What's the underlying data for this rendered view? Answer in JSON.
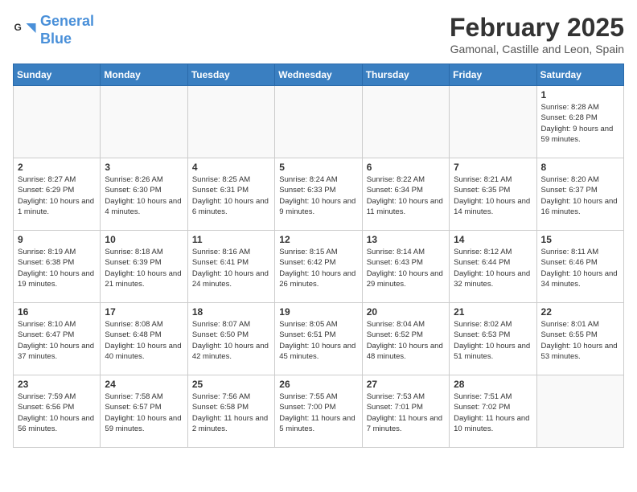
{
  "logo": {
    "line1": "General",
    "line2": "Blue"
  },
  "title": "February 2025",
  "location": "Gamonal, Castille and Leon, Spain",
  "weekdays": [
    "Sunday",
    "Monday",
    "Tuesday",
    "Wednesday",
    "Thursday",
    "Friday",
    "Saturday"
  ],
  "weeks": [
    [
      {
        "day": "",
        "info": ""
      },
      {
        "day": "",
        "info": ""
      },
      {
        "day": "",
        "info": ""
      },
      {
        "day": "",
        "info": ""
      },
      {
        "day": "",
        "info": ""
      },
      {
        "day": "",
        "info": ""
      },
      {
        "day": "1",
        "info": "Sunrise: 8:28 AM\nSunset: 6:28 PM\nDaylight: 9 hours and 59 minutes."
      }
    ],
    [
      {
        "day": "2",
        "info": "Sunrise: 8:27 AM\nSunset: 6:29 PM\nDaylight: 10 hours and 1 minute."
      },
      {
        "day": "3",
        "info": "Sunrise: 8:26 AM\nSunset: 6:30 PM\nDaylight: 10 hours and 4 minutes."
      },
      {
        "day": "4",
        "info": "Sunrise: 8:25 AM\nSunset: 6:31 PM\nDaylight: 10 hours and 6 minutes."
      },
      {
        "day": "5",
        "info": "Sunrise: 8:24 AM\nSunset: 6:33 PM\nDaylight: 10 hours and 9 minutes."
      },
      {
        "day": "6",
        "info": "Sunrise: 8:22 AM\nSunset: 6:34 PM\nDaylight: 10 hours and 11 minutes."
      },
      {
        "day": "7",
        "info": "Sunrise: 8:21 AM\nSunset: 6:35 PM\nDaylight: 10 hours and 14 minutes."
      },
      {
        "day": "8",
        "info": "Sunrise: 8:20 AM\nSunset: 6:37 PM\nDaylight: 10 hours and 16 minutes."
      }
    ],
    [
      {
        "day": "9",
        "info": "Sunrise: 8:19 AM\nSunset: 6:38 PM\nDaylight: 10 hours and 19 minutes."
      },
      {
        "day": "10",
        "info": "Sunrise: 8:18 AM\nSunset: 6:39 PM\nDaylight: 10 hours and 21 minutes."
      },
      {
        "day": "11",
        "info": "Sunrise: 8:16 AM\nSunset: 6:41 PM\nDaylight: 10 hours and 24 minutes."
      },
      {
        "day": "12",
        "info": "Sunrise: 8:15 AM\nSunset: 6:42 PM\nDaylight: 10 hours and 26 minutes."
      },
      {
        "day": "13",
        "info": "Sunrise: 8:14 AM\nSunset: 6:43 PM\nDaylight: 10 hours and 29 minutes."
      },
      {
        "day": "14",
        "info": "Sunrise: 8:12 AM\nSunset: 6:44 PM\nDaylight: 10 hours and 32 minutes."
      },
      {
        "day": "15",
        "info": "Sunrise: 8:11 AM\nSunset: 6:46 PM\nDaylight: 10 hours and 34 minutes."
      }
    ],
    [
      {
        "day": "16",
        "info": "Sunrise: 8:10 AM\nSunset: 6:47 PM\nDaylight: 10 hours and 37 minutes."
      },
      {
        "day": "17",
        "info": "Sunrise: 8:08 AM\nSunset: 6:48 PM\nDaylight: 10 hours and 40 minutes."
      },
      {
        "day": "18",
        "info": "Sunrise: 8:07 AM\nSunset: 6:50 PM\nDaylight: 10 hours and 42 minutes."
      },
      {
        "day": "19",
        "info": "Sunrise: 8:05 AM\nSunset: 6:51 PM\nDaylight: 10 hours and 45 minutes."
      },
      {
        "day": "20",
        "info": "Sunrise: 8:04 AM\nSunset: 6:52 PM\nDaylight: 10 hours and 48 minutes."
      },
      {
        "day": "21",
        "info": "Sunrise: 8:02 AM\nSunset: 6:53 PM\nDaylight: 10 hours and 51 minutes."
      },
      {
        "day": "22",
        "info": "Sunrise: 8:01 AM\nSunset: 6:55 PM\nDaylight: 10 hours and 53 minutes."
      }
    ],
    [
      {
        "day": "23",
        "info": "Sunrise: 7:59 AM\nSunset: 6:56 PM\nDaylight: 10 hours and 56 minutes."
      },
      {
        "day": "24",
        "info": "Sunrise: 7:58 AM\nSunset: 6:57 PM\nDaylight: 10 hours and 59 minutes."
      },
      {
        "day": "25",
        "info": "Sunrise: 7:56 AM\nSunset: 6:58 PM\nDaylight: 11 hours and 2 minutes."
      },
      {
        "day": "26",
        "info": "Sunrise: 7:55 AM\nSunset: 7:00 PM\nDaylight: 11 hours and 5 minutes."
      },
      {
        "day": "27",
        "info": "Sunrise: 7:53 AM\nSunset: 7:01 PM\nDaylight: 11 hours and 7 minutes."
      },
      {
        "day": "28",
        "info": "Sunrise: 7:51 AM\nSunset: 7:02 PM\nDaylight: 11 hours and 10 minutes."
      },
      {
        "day": "",
        "info": ""
      }
    ]
  ]
}
